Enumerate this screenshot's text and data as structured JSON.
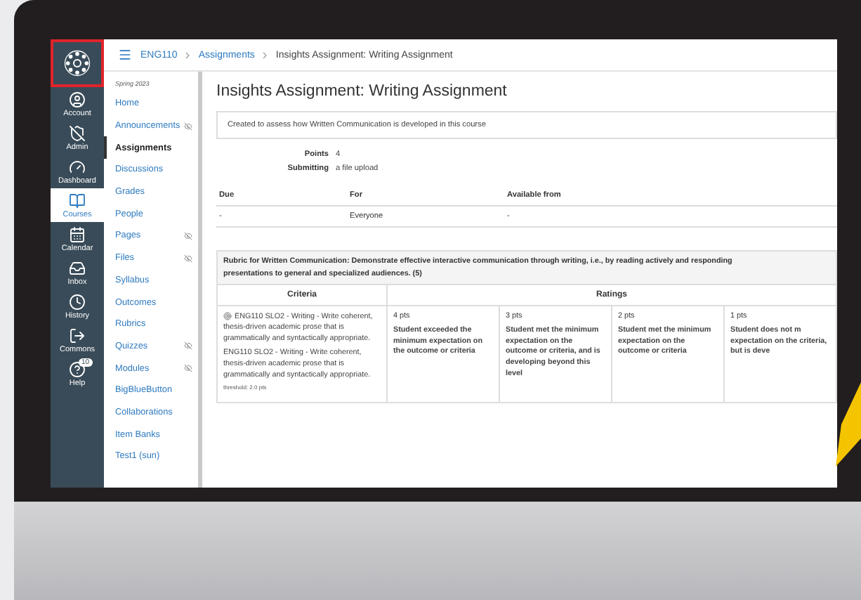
{
  "global_nav": [
    {
      "label": "Account",
      "selected": false
    },
    {
      "label": "Admin",
      "selected": false
    },
    {
      "label": "Dashboard",
      "selected": false
    },
    {
      "label": "Courses",
      "selected": true
    },
    {
      "label": "Calendar",
      "selected": false
    },
    {
      "label": "Inbox",
      "selected": false
    },
    {
      "label": "History",
      "selected": false
    },
    {
      "label": "Commons",
      "selected": false
    },
    {
      "label": "Help",
      "selected": false,
      "badge": "10"
    }
  ],
  "breadcrumb": [
    {
      "label": "ENG110",
      "link": true
    },
    {
      "label": "Assignments",
      "link": true
    },
    {
      "label": "Insights Assignment: Writing Assignment",
      "link": false
    }
  ],
  "course_nav": {
    "term": "Spring 2023",
    "items": [
      {
        "label": "Home",
        "selected": false,
        "hidden": false
      },
      {
        "label": "Announcements",
        "selected": false,
        "hidden": true
      },
      {
        "label": "Assignments",
        "selected": true,
        "hidden": false
      },
      {
        "label": "Discussions",
        "selected": false,
        "hidden": false
      },
      {
        "label": "Grades",
        "selected": false,
        "hidden": false
      },
      {
        "label": "People",
        "selected": false,
        "hidden": false
      },
      {
        "label": "Pages",
        "selected": false,
        "hidden": true
      },
      {
        "label": "Files",
        "selected": false,
        "hidden": true
      },
      {
        "label": "Syllabus",
        "selected": false,
        "hidden": false
      },
      {
        "label": "Outcomes",
        "selected": false,
        "hidden": false
      },
      {
        "label": "Rubrics",
        "selected": false,
        "hidden": false
      },
      {
        "label": "Quizzes",
        "selected": false,
        "hidden": true
      },
      {
        "label": "Modules",
        "selected": false,
        "hidden": true
      },
      {
        "label": "BigBlueButton",
        "selected": false,
        "hidden": false
      },
      {
        "label": "Collaborations",
        "selected": false,
        "hidden": false
      },
      {
        "label": "Item Banks",
        "selected": false,
        "hidden": false
      },
      {
        "label": "Test1 (sun)",
        "selected": false,
        "hidden": false
      }
    ]
  },
  "title": "Insights Assignment: Writing Assignment",
  "description": "Created to assess how Written Communication is developed in this course",
  "details": [
    {
      "label": "Points",
      "value": "4"
    },
    {
      "label": "Submitting",
      "value": "a file upload"
    }
  ],
  "dates": {
    "columns": [
      "Due",
      "For",
      "Available from"
    ],
    "rows": [
      [
        "-",
        "Everyone",
        "-"
      ]
    ]
  },
  "rubric": {
    "title_lines": [
      "Rubric for Written Communication: Demonstrate effective interactive communication through writing, i.e., by reading actively and responding",
      "presentations to general and specialized audiences. (5)"
    ],
    "columns": [
      "Criteria",
      "Ratings"
    ],
    "criterion": {
      "outcome": "ENG110 SLO2 - Writing - Write coherent, thesis-driven academic prose that is grammatically and syntactically appropriate.",
      "description": "ENG110 SLO2 - Writing - Write coherent, thesis-driven academic prose that is grammatically and syntactically appropriate.",
      "threshold": "threshold: 2.0 pts"
    },
    "ratings": [
      {
        "points": "4 pts",
        "description": "Student exceeded the minimum expectation on the outcome or criteria"
      },
      {
        "points": "3 pts",
        "description": "Student met the minimum expectation on the outcome or criteria, and is developing beyond this level"
      },
      {
        "points": "2 pts",
        "description": "Student met the minimum expectation on the outcome or criteria"
      },
      {
        "points": "1 pts",
        "description": "Student does not m expectation on the criteria, but is deve"
      }
    ]
  }
}
